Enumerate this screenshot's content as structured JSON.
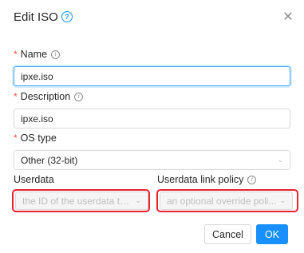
{
  "dialog": {
    "title": "Edit ISO",
    "help_icon": "question-circle-icon",
    "close_icon": "close-icon"
  },
  "form": {
    "name": {
      "label": "Name",
      "required": true,
      "value": "ipxe.iso"
    },
    "description": {
      "label": "Description",
      "required": true,
      "value": "ipxe.iso"
    },
    "os_type": {
      "label": "OS type",
      "required": true,
      "value": "Other (32-bit)"
    },
    "userdata": {
      "label": "Userdata",
      "placeholder": "the ID of the userdata th..."
    },
    "userdata_link_policy": {
      "label": "Userdata link policy",
      "placeholder": "an optional override poli..."
    }
  },
  "buttons": {
    "cancel": "Cancel",
    "ok": "OK"
  },
  "colors": {
    "primary": "#1890ff",
    "required": "#ff4d4f",
    "highlight": "#e8232f"
  }
}
